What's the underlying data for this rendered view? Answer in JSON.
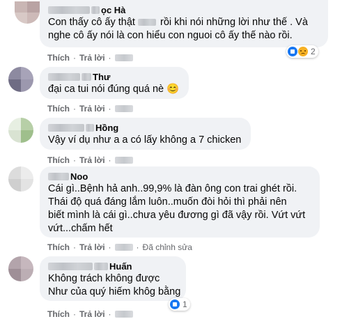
{
  "actions": {
    "like": "Thích",
    "reply": "Trả lời",
    "separator": "·",
    "edited": "Đã chỉnh sửa"
  },
  "comments": [
    {
      "name_suffix": "ọc Hà",
      "lines": [
        "Con thấy cô ấy thật",
        "rồi khi nói những lời như thế . Và",
        "nghe cô ấy nói là con hiểu con nguoi cô ấy thế nào rồi."
      ],
      "reaction_count": "2",
      "reactions": [
        "like-icon",
        "sad-icon"
      ]
    },
    {
      "name_suffix": "Thư",
      "lines": [
        "đại ca tui nói đúng quá nè 😊"
      ]
    },
    {
      "name_suffix": "Hồng",
      "lines": [
        "Vậy ví dụ như a a có lấy không a 7 chicken"
      ]
    },
    {
      "name_suffix": "Noo",
      "lines": [
        "Cái gì..Bệnh hả anh..99,9% là đàn ông con trai ghét rồi.",
        "Thái độ quá đáng lắm luôn..muốn đòi hỏi thì phải nên",
        "biết mình là cái gì..chưa yêu đương gì đã vậy rồi. Vứt vứt",
        "vứt...chấm hết"
      ],
      "edited": true
    },
    {
      "name_suffix": "Huấn",
      "lines": [
        "Không trách không được",
        "Như của quý hiếm khôg bằng"
      ],
      "reaction_count": "1",
      "reactions": [
        "like-icon"
      ]
    }
  ],
  "colors": {
    "bubble": "#f0f2f5",
    "action": "#65676b",
    "like": "#1877f2",
    "sad": "#f7b125"
  }
}
